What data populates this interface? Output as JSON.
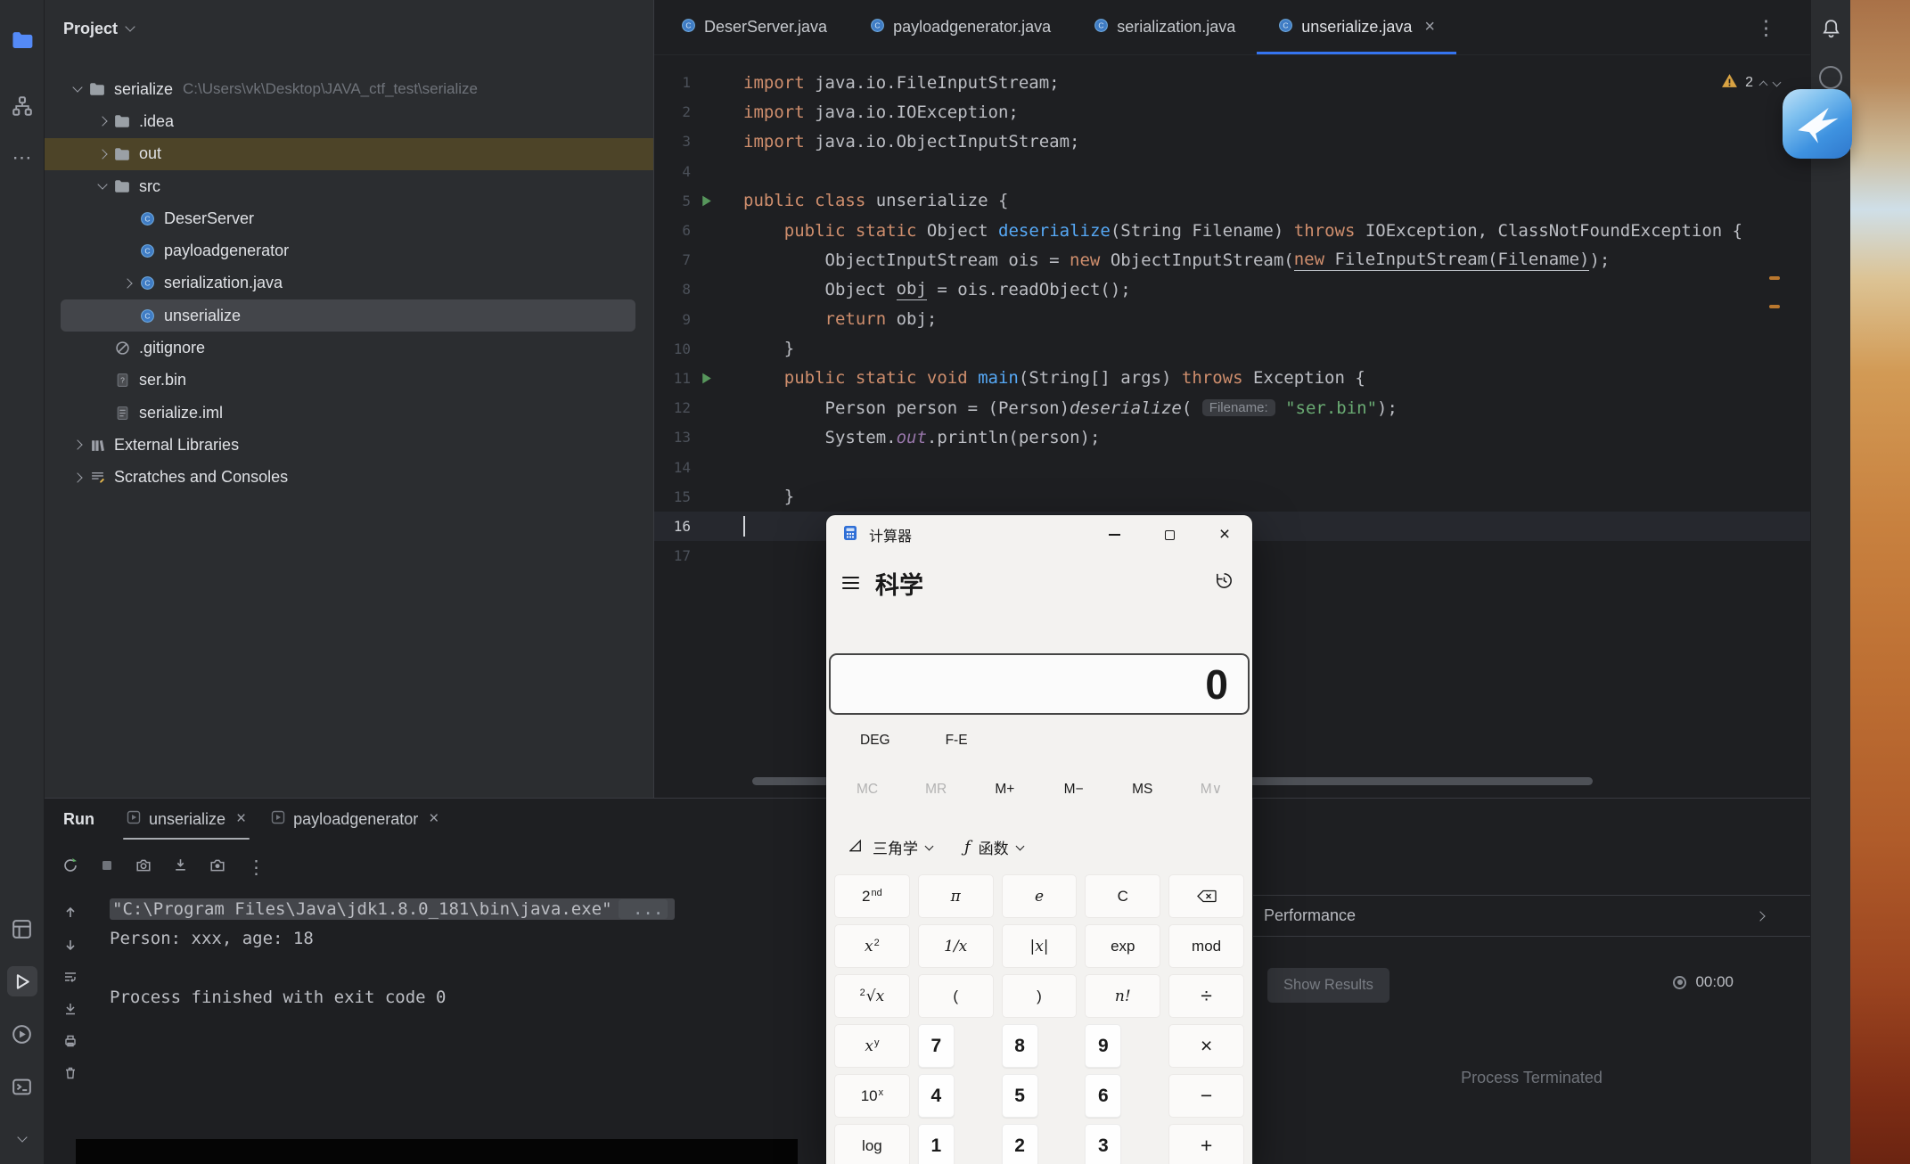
{
  "icons": {
    "close_glyph": "×",
    "kebab_glyph": "⋮",
    "more_glyph": "⋯"
  },
  "activity_bar": {
    "items": [
      "project",
      "structure",
      "more",
      "services",
      "run",
      "profiler",
      "terminal",
      "more-bottom"
    ]
  },
  "project_panel": {
    "title": "Project",
    "tree": [
      {
        "label": "serialize",
        "hint": "C:\\Users\\vk\\Desktop\\JAVA_ctf_test\\serialize",
        "icon": "folder",
        "level": 0,
        "chevron": "down"
      },
      {
        "label": ".idea",
        "icon": "folder",
        "level": 1,
        "chevron": "right"
      },
      {
        "label": "out",
        "icon": "folder",
        "level": 1,
        "chevron": "right",
        "state": "drop-target"
      },
      {
        "label": "src",
        "icon": "folder",
        "level": 1,
        "chevron": "down"
      },
      {
        "label": "DeserServer",
        "icon": "class",
        "level": 2
      },
      {
        "label": "payloadgenerator",
        "icon": "class",
        "level": 2
      },
      {
        "label": "serialization.java",
        "icon": "class",
        "level": 2,
        "chevron": "right"
      },
      {
        "label": "unserialize",
        "icon": "class",
        "level": 2,
        "state": "selected"
      },
      {
        "label": ".gitignore",
        "icon": "ignore",
        "level": 1
      },
      {
        "label": "ser.bin",
        "icon": "unknown-file",
        "level": 1
      },
      {
        "label": "serialize.iml",
        "icon": "iml-file",
        "level": 1
      },
      {
        "label": "External Libraries",
        "icon": "libraries",
        "level": 0,
        "chevron": "right"
      },
      {
        "label": "Scratches and Consoles",
        "icon": "scratches",
        "level": 0,
        "chevron": "right"
      }
    ]
  },
  "editor": {
    "tabs": [
      {
        "label": "DeserServer.java"
      },
      {
        "label": "payloadgenerator.java"
      },
      {
        "label": "serialization.java"
      },
      {
        "label": "unserialize.java",
        "active": true
      }
    ],
    "inspections": {
      "warning_count": "2"
    },
    "code": [
      {
        "n": 1,
        "seg": [
          {
            "t": "import ",
            "c": "kw"
          },
          {
            "t": "java.io.FileInputStream;",
            "c": "pl"
          }
        ]
      },
      {
        "n": 2,
        "seg": [
          {
            "t": "import ",
            "c": "kw"
          },
          {
            "t": "java.io.IOException;",
            "c": "pl"
          }
        ]
      },
      {
        "n": 3,
        "seg": [
          {
            "t": "import ",
            "c": "kw"
          },
          {
            "t": "java.io.ObjectInputStream;",
            "c": "pl"
          }
        ]
      },
      {
        "n": 4,
        "seg": []
      },
      {
        "n": 5,
        "run": true,
        "seg": [
          {
            "t": "public class ",
            "c": "kw"
          },
          {
            "t": "unserialize {",
            "c": "pl"
          }
        ]
      },
      {
        "n": 6,
        "seg": [
          {
            "t": "    ",
            "c": "pl"
          },
          {
            "t": "public static ",
            "c": "kw"
          },
          {
            "t": "Object ",
            "c": "pl"
          },
          {
            "t": "deserialize",
            "c": "method"
          },
          {
            "t": "(String Filename) ",
            "c": "pl"
          },
          {
            "t": "throws ",
            "c": "kw"
          },
          {
            "t": "IOException, ClassNotFoundException {",
            "c": "pl"
          }
        ]
      },
      {
        "n": 7,
        "seg": [
          {
            "t": "        ObjectInputStream ois = ",
            "c": "pl"
          },
          {
            "t": "new ",
            "c": "kw"
          },
          {
            "t": "ObjectInputStream(",
            "c": "pl"
          },
          {
            "t": "new ",
            "c": "kw u"
          },
          {
            "t": "FileInputStream(Filename)",
            "c": "pl u"
          },
          {
            "t": ");",
            "c": "pl"
          }
        ]
      },
      {
        "n": 8,
        "seg": [
          {
            "t": "        Object ",
            "c": "pl"
          },
          {
            "t": "obj",
            "c": "pl u"
          },
          {
            "t": " = ois.readObject();",
            "c": "pl"
          }
        ]
      },
      {
        "n": 9,
        "seg": [
          {
            "t": "        ",
            "c": "pl"
          },
          {
            "t": "return ",
            "c": "kw"
          },
          {
            "t": "obj;",
            "c": "pl"
          }
        ]
      },
      {
        "n": 10,
        "seg": [
          {
            "t": "    }",
            "c": "pl"
          }
        ]
      },
      {
        "n": 11,
        "run": true,
        "seg": [
          {
            "t": "    ",
            "c": "pl"
          },
          {
            "t": "public static void ",
            "c": "kw"
          },
          {
            "t": "main",
            "c": "method"
          },
          {
            "t": "(String[] args) ",
            "c": "pl"
          },
          {
            "t": "throws ",
            "c": "kw"
          },
          {
            "t": "Exception {",
            "c": "pl"
          }
        ]
      },
      {
        "n": 12,
        "seg": [
          {
            "t": "        Person person = (Person)",
            "c": "pl"
          },
          {
            "t": "deserialize",
            "c": "call"
          },
          {
            "t": "( ",
            "c": "pl"
          },
          {
            "t": "Filename:",
            "c": "hint"
          },
          {
            "t": " ",
            "c": "pl"
          },
          {
            "t": "\"ser.bin\"",
            "c": "str"
          },
          {
            "t": ");",
            "c": "pl"
          }
        ]
      },
      {
        "n": 13,
        "seg": [
          {
            "t": "        System.",
            "c": "pl"
          },
          {
            "t": "out",
            "c": "field"
          },
          {
            "t": ".println(person);",
            "c": "pl"
          }
        ]
      },
      {
        "n": 14,
        "seg": []
      },
      {
        "n": 15,
        "seg": [
          {
            "t": "    }",
            "c": "pl"
          }
        ]
      },
      {
        "n": 16,
        "caret": true,
        "seg": []
      },
      {
        "n": 17,
        "seg": []
      }
    ]
  },
  "run_panel": {
    "title": "Run",
    "tabs": [
      {
        "label": "unserialize",
        "active": true
      },
      {
        "label": "payloadgenerator"
      }
    ],
    "console": [
      {
        "text": "\"C:\\Program Files\\Java\\jdk1.8.0_181\\bin\\java.exe\"",
        "fold": " ...",
        "selected": true
      },
      {
        "text": "Person: xxx, age: 18"
      },
      {
        "text": ""
      },
      {
        "text": "Process finished with exit code 0"
      }
    ]
  },
  "profiler_panel": {
    "header": "Performance",
    "show_results_label": "Show Results",
    "timer": "00:00",
    "status": "Process Terminated"
  },
  "calculator": {
    "title": "计算器",
    "mode": "科学",
    "display_value": "0",
    "angle_button": "DEG",
    "fe_button": "F-E",
    "memory": [
      {
        "label": "MC",
        "disabled": true
      },
      {
        "label": "MR",
        "disabled": true
      },
      {
        "label": "M+"
      },
      {
        "label": "M−"
      },
      {
        "label": "MS"
      },
      {
        "label": "M∨",
        "disabled": true
      }
    ],
    "category_buttons": [
      {
        "label": "三角学",
        "icon": "triangle"
      },
      {
        "label": "函数",
        "icon": "function"
      }
    ],
    "keys": [
      {
        "main": "2",
        "sup": "nd",
        "type": "fn"
      },
      {
        "main": "π",
        "type": "fn",
        "italic": true
      },
      {
        "main": "e",
        "type": "fn",
        "italic": true
      },
      {
        "main": "C",
        "type": "fn"
      },
      {
        "main": "⌫",
        "type": "fn",
        "name": "backspace"
      },
      {
        "main": "x",
        "sup": "2",
        "type": "fn",
        "italic": true
      },
      {
        "main": "1/x",
        "type": "fn",
        "italic": true
      },
      {
        "main": "|x|",
        "type": "fn",
        "italic": true
      },
      {
        "main": "exp",
        "type": "fn"
      },
      {
        "main": "mod",
        "type": "fn"
      },
      {
        "pre_sup": "2",
        "main": "√x",
        "type": "fn",
        "italic": true
      },
      {
        "main": "(",
        "type": "fn"
      },
      {
        "main": ")",
        "type": "fn"
      },
      {
        "main": "n!",
        "type": "fn",
        "italic": true
      },
      {
        "main": "÷",
        "type": "op"
      },
      {
        "main": "x",
        "sup": "y",
        "type": "fn",
        "italic": true
      },
      {
        "main": "7",
        "type": "num"
      },
      {
        "main": "8",
        "type": "num"
      },
      {
        "main": "9",
        "type": "num"
      },
      {
        "main": "×",
        "type": "op"
      },
      {
        "main": "10",
        "sup": "x",
        "type": "fn"
      },
      {
        "main": "4",
        "type": "num"
      },
      {
        "main": "5",
        "type": "num"
      },
      {
        "main": "6",
        "type": "num"
      },
      {
        "main": "−",
        "type": "op"
      },
      {
        "main": "log",
        "type": "fn"
      },
      {
        "main": "1",
        "type": "num"
      },
      {
        "main": "2",
        "type": "num"
      },
      {
        "main": "3",
        "type": "num"
      },
      {
        "main": "+",
        "type": "op"
      }
    ]
  }
}
